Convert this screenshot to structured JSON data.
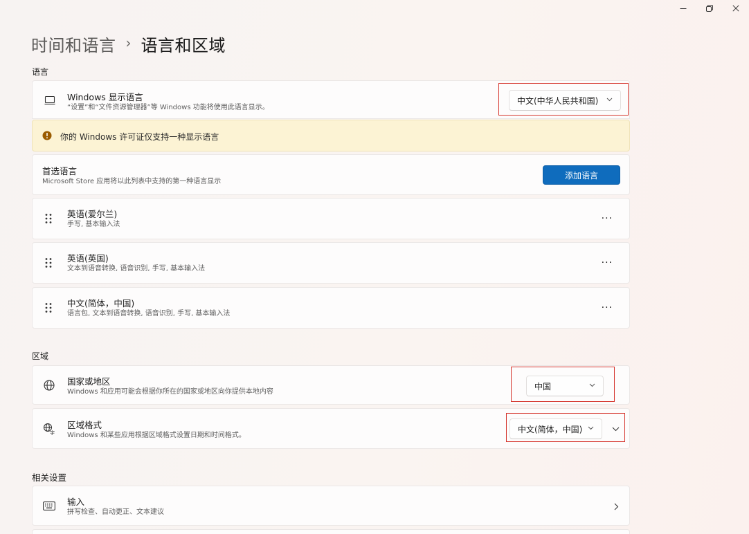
{
  "window": {
    "minimize_icon": "minimize-icon",
    "restore_icon": "restore-icon",
    "close_icon": "close-icon"
  },
  "breadcrumb": {
    "parent": "时间和语言",
    "separator": "›",
    "current": "语言和区域"
  },
  "language_section": {
    "label": "语言",
    "display_language": {
      "title": "Windows 显示语言",
      "subtitle": "“设置”和“文件资源管理器”等 Windows 功能将使用此语言显示。",
      "selected": "中文(中华人民共和国)",
      "icon": "monitor-icon"
    },
    "license_warning": {
      "text": "你的 Windows 许可证仅支持一种显示语言",
      "icon": "warning-icon"
    },
    "preferred": {
      "title": "首选语言",
      "subtitle": "Microsoft Store 应用将以此列表中支持的第一种语言显示",
      "add_button": "添加语言"
    },
    "languages": [
      {
        "name": "英语(爱尔兰)",
        "features": "手写, 基本输入法",
        "more": "···"
      },
      {
        "name": "英语(英国)",
        "features": "文本到语音转换, 语音识别, 手写, 基本输入法",
        "more": "···"
      },
      {
        "name": "中文(简体，中国)",
        "features": "语言包, 文本到语音转换, 语音识别, 手写, 基本输入法",
        "more": "···"
      }
    ]
  },
  "region_section": {
    "label": "区域",
    "country": {
      "title": "国家或地区",
      "subtitle": "Windows 和应用可能会根据你所在的国家或地区向你提供本地内容",
      "selected": "中国",
      "icon": "globe-icon"
    },
    "format": {
      "title": "区域格式",
      "subtitle": "Windows 和某些应用根据区域格式设置日期和时间格式。",
      "selected": "中文(简体，中国)",
      "icon": "region-format-icon"
    }
  },
  "related_section": {
    "label": "相关设置",
    "typing": {
      "title": "输入",
      "subtitle": "拼写检查、自动更正、文本建议",
      "icon": "keyboard-icon"
    }
  },
  "colors": {
    "accent": "#0f6cbd",
    "highlight_box": "#d5342c",
    "warning_bg": "#fcf3d4"
  }
}
